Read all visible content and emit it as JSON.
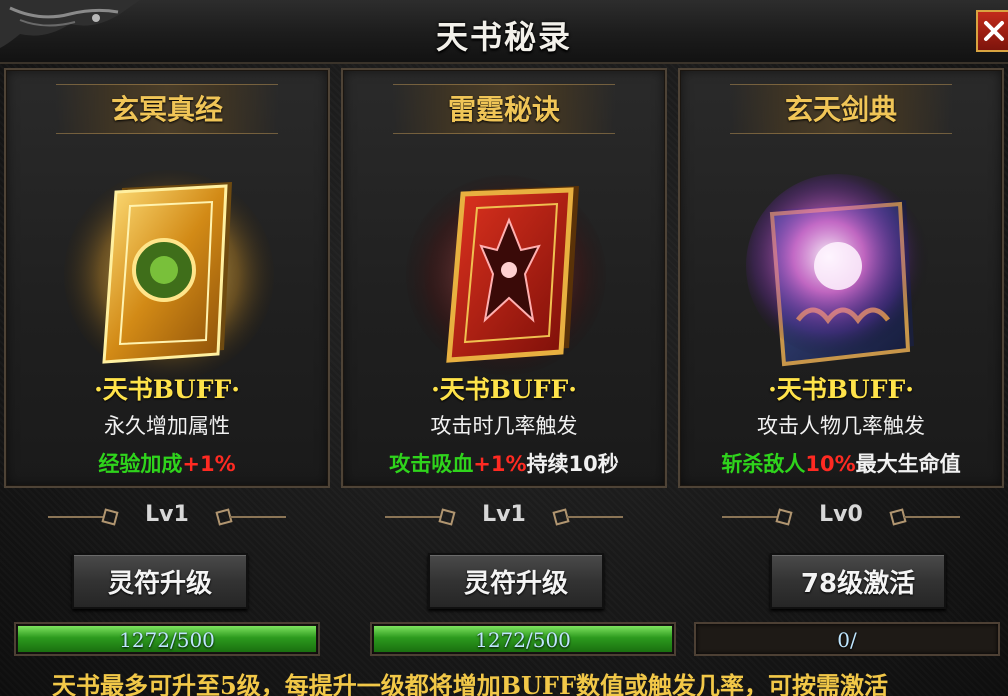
{
  "window": {
    "title": "天书秘录",
    "close_label": "X"
  },
  "cards": [
    {
      "name": "玄冥真经",
      "buff_heading": "·天书BUFF·",
      "description": "永久增加属性",
      "effect": {
        "part1": "经验加成",
        "part2": "+1%",
        "part3": ""
      },
      "level": "Lv1",
      "button_label": "灵符升级",
      "progress_text": "1272/500",
      "progress_fraction": 1.0,
      "book_icon": "golden-book-icon",
      "book_color": "#e9b23a"
    },
    {
      "name": "雷霆秘诀",
      "buff_heading": "·天书BUFF·",
      "description": "攻击时几率触发",
      "effect": {
        "part1": "攻击吸血",
        "part2": "+1%",
        "part3": "持续10秒"
      },
      "level": "Lv1",
      "button_label": "灵符升级",
      "progress_text": "1272/500",
      "progress_fraction": 1.0,
      "book_icon": "red-demon-book-icon",
      "book_color": "#c8281c"
    },
    {
      "name": "玄天剑典",
      "buff_heading": "·天书BUFF·",
      "description": "攻击人物几率触发",
      "effect": {
        "part1": "斩杀敌人",
        "part2": "10%",
        "part3": "最大生命值"
      },
      "level": "Lv0",
      "button_label": "78级激活",
      "progress_text": "0/",
      "progress_fraction": 0.0,
      "book_icon": "arcane-blue-book-icon",
      "book_color": "#c050e0"
    }
  ],
  "footer_note": "天书最多可升至5级，每提升一级都将增加BUFF数值或触发几率，可按需激活",
  "colors": {
    "title_gold": "#f0c557",
    "buff_yellow": "#ffe34a",
    "effect_green": "#2fd41c",
    "effect_red": "#ff2a22",
    "progress_green": "#2c9a1e"
  }
}
